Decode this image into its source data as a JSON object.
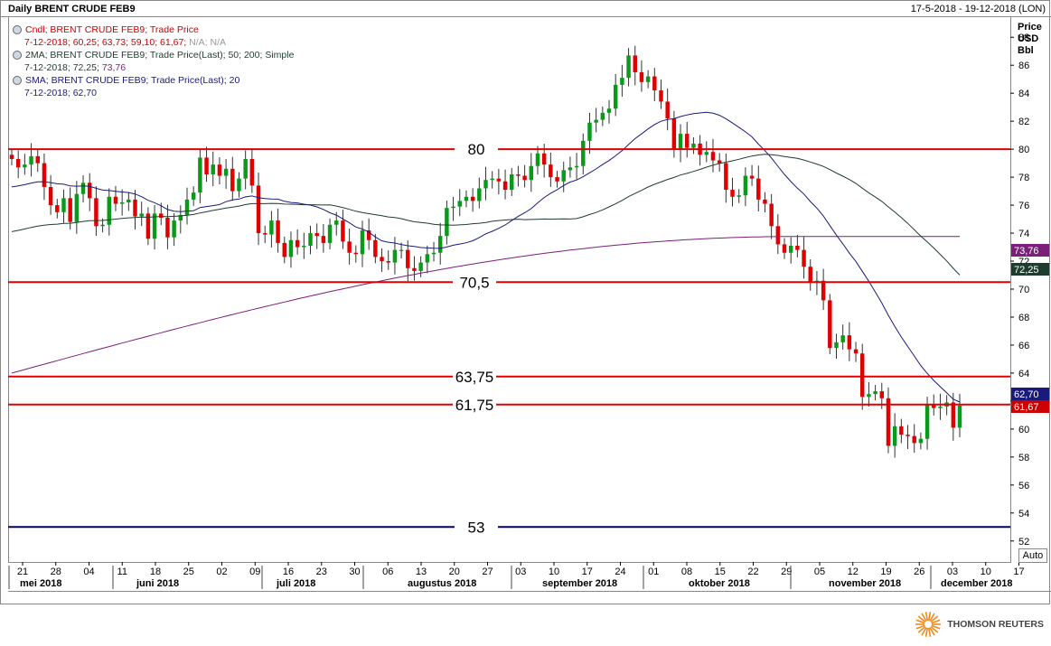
{
  "chart_data": {
    "type": "candlestick",
    "title": "Daily BRENT CRUDE FEB9",
    "date_range": "17-5-2018 - 19-12-2018 (LON)",
    "legend": [
      {
        "line1": "Cndl; BRENT CRUDE FEB9; Trade Price",
        "line2a": "7-12-2018; 60,25; 63,73; 59,10; 61,67;",
        "line2b": " N/A; N/A",
        "color": "#cc0000"
      },
      {
        "line1": "2MA; BRENT CRUDE FEB9; Trade Price(Last);  50; 200; Simple",
        "line2a": "7-12-2018; 72,25; ",
        "line2b": "73,76",
        "color": "#1f3d2e",
        "color2": "#7b1f7b"
      },
      {
        "line1": "SMA; BRENT CRUDE FEB9; Trade Price(Last);  20",
        "line2a": "7-12-2018; 62,70",
        "line2b": "",
        "color": "#1a1a7a"
      }
    ],
    "y_axis": {
      "title_lines": [
        "Price",
        "USD",
        "Bbl"
      ],
      "min": 50.5,
      "max": 89.5,
      "ticks": [
        52,
        54,
        56,
        58,
        60,
        62,
        64,
        66,
        68,
        70,
        72,
        74,
        76,
        78,
        80,
        82,
        84,
        86,
        88
      ]
    },
    "x_axis": {
      "day_ticks": [
        "21",
        "28",
        "04",
        "11",
        "18",
        "25",
        "02",
        "09",
        "16",
        "23",
        "30",
        "06",
        "13",
        "20",
        "27",
        "03",
        "10",
        "17",
        "24",
        "01",
        "08",
        "15",
        "22",
        "29",
        "05",
        "12",
        "19",
        "26",
        "03",
        "10",
        "17"
      ],
      "months": [
        "mei 2018",
        "juni 2018",
        "juli 2018",
        "augustus 2018",
        "september 2018",
        "oktober 2018",
        "november 2018",
        "december 2018"
      ]
    },
    "horizontal_lines": [
      {
        "value": 80,
        "label": "80",
        "color": "#e00000"
      },
      {
        "value": 70.5,
        "label": "70,5",
        "color": "#e00000"
      },
      {
        "value": 63.75,
        "label": "63,75",
        "color": "#e00000"
      },
      {
        "value": 61.75,
        "label": "61,75",
        "color": "#e00000"
      },
      {
        "value": 53,
        "label": "53",
        "color": "#000066"
      }
    ],
    "value_tags": [
      {
        "value": 73.76,
        "label": "73,76",
        "bg": "#7b1f7b"
      },
      {
        "value": 72.25,
        "label": "72,25",
        "bg": "#1f3d2e"
      },
      {
        "value": 62.7,
        "label": "62,70",
        "bg": "#1a1a7a"
      },
      {
        "value": 61.67,
        "label": "61,67",
        "bg": "#cc0000"
      }
    ],
    "closes": [
      79.3,
      78.7,
      78.9,
      79.5,
      79.0,
      77.3,
      76.0,
      75.5,
      76.5,
      74.8,
      76.8,
      77.6,
      76.5,
      74.5,
      74.6,
      76.6,
      76.1,
      76.2,
      76.4,
      75.2,
      75.4,
      73.6,
      75.4,
      75.1,
      73.7,
      74.9,
      75.3,
      76.4,
      76.9,
      79.4,
      78.2,
      78.9,
      78.1,
      78.6,
      77.0,
      77.9,
      79.3,
      77.4,
      74.0,
      73.9,
      74.9,
      73.3,
      72.3,
      73.5,
      73.0,
      73.1,
      74.0,
      73.8,
      73.3,
      74.6,
      74.9,
      73.4,
      72.6,
      72.5,
      74.2,
      73.5,
      72.3,
      72.0,
      71.9,
      72.8,
      72.8,
      71.5,
      71.3,
      71.9,
      72.5,
      72.6,
      73.8,
      75.8,
      75.9,
      76.3,
      76.6,
      76.3,
      77.2,
      77.8,
      77.9,
      77.7,
      77.1,
      78.2,
      78.1,
      77.8,
      78.8,
      79.7,
      78.9,
      78.0,
      77.7,
      78.5,
      78.7,
      78.8,
      80.6,
      81.9,
      82.1,
      82.6,
      82.9,
      84.6,
      85.1,
      86.7,
      85.5,
      84.8,
      85.2,
      84.2,
      83.4,
      82.2,
      80.0,
      81.1,
      80.1,
      80.4,
      79.6,
      79.8,
      79.2,
      79.0,
      77.1,
      76.6,
      76.7,
      78.1,
      77.9,
      76.4,
      76.1,
      74.5,
      73.2,
      72.6,
      73.1,
      72.8,
      71.6,
      70.5,
      70.6,
      69.2,
      65.8,
      66.2,
      66.7,
      65.7,
      65.4,
      62.3,
      62.5,
      62.7,
      62.2,
      58.8,
      60.2,
      59.6,
      59.5,
      59.0,
      59.3,
      61.7,
      61.5,
      61.6,
      61.9,
      60.1,
      61.67
    ],
    "ma20_last": 62.7,
    "ma50_last": 72.25,
    "ma200_last": 73.76
  },
  "footer": {
    "brand": "THOMSON REUTERS",
    "auto_button": "Auto"
  }
}
